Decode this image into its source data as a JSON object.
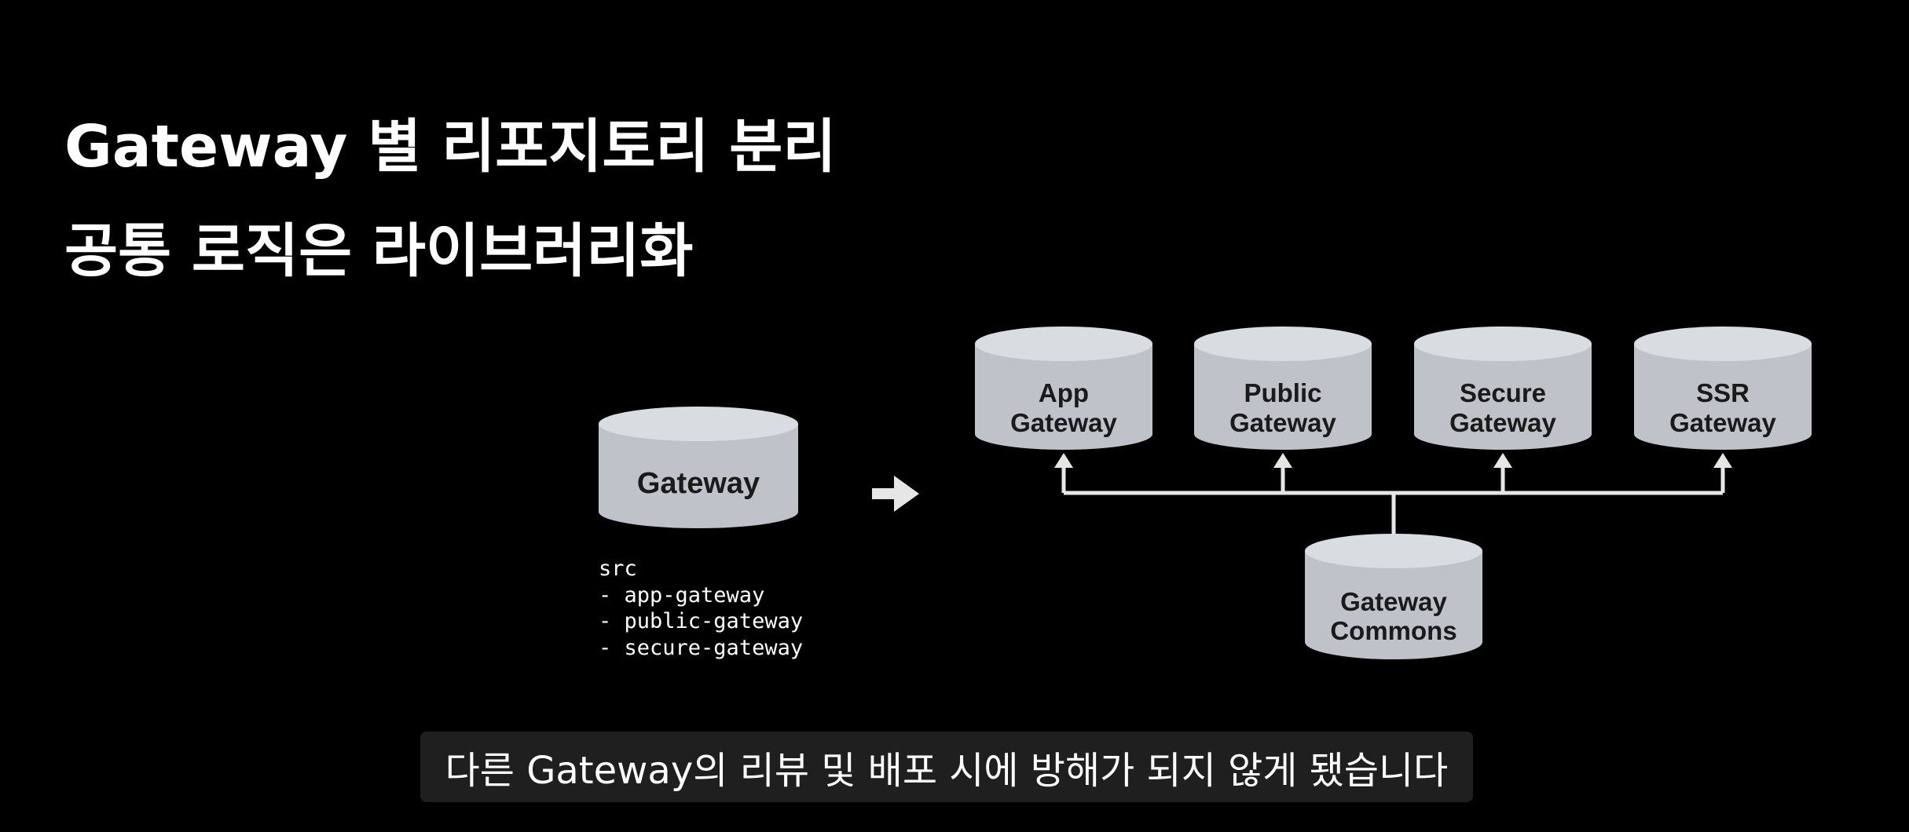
{
  "slide": {
    "title_line_1": "Gateway 별 리포지토리 분리",
    "title_line_2": "공통 로직은 라이브러리화"
  },
  "before": {
    "repo_label": "Gateway",
    "src_lines": [
      "src",
      "- app-gateway",
      "- public-gateway",
      "- secure-gateway"
    ]
  },
  "after": {
    "gateways": [
      {
        "line1": "App",
        "line2": "Gateway"
      },
      {
        "line1": "Public",
        "line2": "Gateway"
      },
      {
        "line1": "Secure",
        "line2": "Gateway"
      },
      {
        "line1": "SSR",
        "line2": "Gateway"
      }
    ],
    "commons": {
      "line1": "Gateway",
      "line2": "Commons"
    }
  },
  "subtitle": "다른 Gateway의 리뷰 및 배포 시에 방해가 되지 않게 됐습니다",
  "colors": {
    "background": "#000000",
    "cylinder_fill": "#bfc3c9",
    "cylinder_top": "#d9dce0",
    "arrow": "#e6e6e6",
    "subtitle_bg": "#1f1f1f"
  },
  "icons": {
    "transition_arrow": "right-arrow-icon"
  }
}
